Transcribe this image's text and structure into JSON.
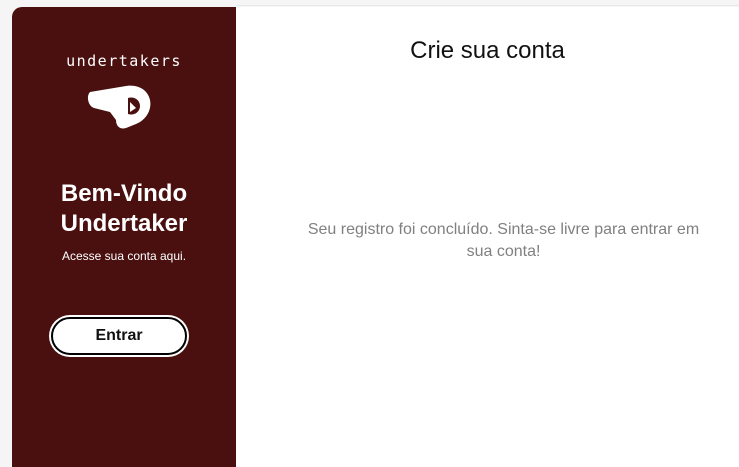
{
  "sidebar": {
    "logo_text": "undertakers",
    "logo_icon": "fist-icon",
    "welcome_line1": "Bem-Vindo",
    "welcome_line2": "Undertaker",
    "subtitle": "Acesse sua conta aqui.",
    "enter_button": "Entrar",
    "background_color": "#4a1010"
  },
  "main": {
    "title": "Crie sua conta",
    "message": "Seu registro foi concluído. Sinta-se livre para entrar em sua conta!"
  }
}
